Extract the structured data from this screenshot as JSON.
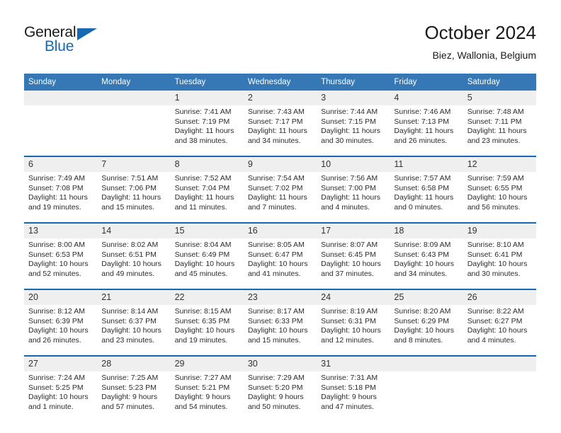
{
  "brand": {
    "word_one": "General",
    "word_two": "Blue",
    "accent_color": "#1668b3"
  },
  "header": {
    "title": "October 2024",
    "subtitle": "Biez, Wallonia, Belgium"
  },
  "calendar": {
    "header_bg": "#3578b5",
    "separator_color": "#1668b3",
    "datebar_bg": "#efefef",
    "weekday_headers": [
      "Sunday",
      "Monday",
      "Tuesday",
      "Wednesday",
      "Thursday",
      "Friday",
      "Saturday"
    ],
    "weeks": [
      [
        {
          "day": "",
          "sunrise": "",
          "sunset": "",
          "daylight": ""
        },
        {
          "day": "",
          "sunrise": "",
          "sunset": "",
          "daylight": ""
        },
        {
          "day": "1",
          "sunrise": "Sunrise: 7:41 AM",
          "sunset": "Sunset: 7:19 PM",
          "daylight": "Daylight: 11 hours and 38 minutes."
        },
        {
          "day": "2",
          "sunrise": "Sunrise: 7:43 AM",
          "sunset": "Sunset: 7:17 PM",
          "daylight": "Daylight: 11 hours and 34 minutes."
        },
        {
          "day": "3",
          "sunrise": "Sunrise: 7:44 AM",
          "sunset": "Sunset: 7:15 PM",
          "daylight": "Daylight: 11 hours and 30 minutes."
        },
        {
          "day": "4",
          "sunrise": "Sunrise: 7:46 AM",
          "sunset": "Sunset: 7:13 PM",
          "daylight": "Daylight: 11 hours and 26 minutes."
        },
        {
          "day": "5",
          "sunrise": "Sunrise: 7:48 AM",
          "sunset": "Sunset: 7:11 PM",
          "daylight": "Daylight: 11 hours and 23 minutes."
        }
      ],
      [
        {
          "day": "6",
          "sunrise": "Sunrise: 7:49 AM",
          "sunset": "Sunset: 7:08 PM",
          "daylight": "Daylight: 11 hours and 19 minutes."
        },
        {
          "day": "7",
          "sunrise": "Sunrise: 7:51 AM",
          "sunset": "Sunset: 7:06 PM",
          "daylight": "Daylight: 11 hours and 15 minutes."
        },
        {
          "day": "8",
          "sunrise": "Sunrise: 7:52 AM",
          "sunset": "Sunset: 7:04 PM",
          "daylight": "Daylight: 11 hours and 11 minutes."
        },
        {
          "day": "9",
          "sunrise": "Sunrise: 7:54 AM",
          "sunset": "Sunset: 7:02 PM",
          "daylight": "Daylight: 11 hours and 7 minutes."
        },
        {
          "day": "10",
          "sunrise": "Sunrise: 7:56 AM",
          "sunset": "Sunset: 7:00 PM",
          "daylight": "Daylight: 11 hours and 4 minutes."
        },
        {
          "day": "11",
          "sunrise": "Sunrise: 7:57 AM",
          "sunset": "Sunset: 6:58 PM",
          "daylight": "Daylight: 11 hours and 0 minutes."
        },
        {
          "day": "12",
          "sunrise": "Sunrise: 7:59 AM",
          "sunset": "Sunset: 6:55 PM",
          "daylight": "Daylight: 10 hours and 56 minutes."
        }
      ],
      [
        {
          "day": "13",
          "sunrise": "Sunrise: 8:00 AM",
          "sunset": "Sunset: 6:53 PM",
          "daylight": "Daylight: 10 hours and 52 minutes."
        },
        {
          "day": "14",
          "sunrise": "Sunrise: 8:02 AM",
          "sunset": "Sunset: 6:51 PM",
          "daylight": "Daylight: 10 hours and 49 minutes."
        },
        {
          "day": "15",
          "sunrise": "Sunrise: 8:04 AM",
          "sunset": "Sunset: 6:49 PM",
          "daylight": "Daylight: 10 hours and 45 minutes."
        },
        {
          "day": "16",
          "sunrise": "Sunrise: 8:05 AM",
          "sunset": "Sunset: 6:47 PM",
          "daylight": "Daylight: 10 hours and 41 minutes."
        },
        {
          "day": "17",
          "sunrise": "Sunrise: 8:07 AM",
          "sunset": "Sunset: 6:45 PM",
          "daylight": "Daylight: 10 hours and 37 minutes."
        },
        {
          "day": "18",
          "sunrise": "Sunrise: 8:09 AM",
          "sunset": "Sunset: 6:43 PM",
          "daylight": "Daylight: 10 hours and 34 minutes."
        },
        {
          "day": "19",
          "sunrise": "Sunrise: 8:10 AM",
          "sunset": "Sunset: 6:41 PM",
          "daylight": "Daylight: 10 hours and 30 minutes."
        }
      ],
      [
        {
          "day": "20",
          "sunrise": "Sunrise: 8:12 AM",
          "sunset": "Sunset: 6:39 PM",
          "daylight": "Daylight: 10 hours and 26 minutes."
        },
        {
          "day": "21",
          "sunrise": "Sunrise: 8:14 AM",
          "sunset": "Sunset: 6:37 PM",
          "daylight": "Daylight: 10 hours and 23 minutes."
        },
        {
          "day": "22",
          "sunrise": "Sunrise: 8:15 AM",
          "sunset": "Sunset: 6:35 PM",
          "daylight": "Daylight: 10 hours and 19 minutes."
        },
        {
          "day": "23",
          "sunrise": "Sunrise: 8:17 AM",
          "sunset": "Sunset: 6:33 PM",
          "daylight": "Daylight: 10 hours and 15 minutes."
        },
        {
          "day": "24",
          "sunrise": "Sunrise: 8:19 AM",
          "sunset": "Sunset: 6:31 PM",
          "daylight": "Daylight: 10 hours and 12 minutes."
        },
        {
          "day": "25",
          "sunrise": "Sunrise: 8:20 AM",
          "sunset": "Sunset: 6:29 PM",
          "daylight": "Daylight: 10 hours and 8 minutes."
        },
        {
          "day": "26",
          "sunrise": "Sunrise: 8:22 AM",
          "sunset": "Sunset: 6:27 PM",
          "daylight": "Daylight: 10 hours and 4 minutes."
        }
      ],
      [
        {
          "day": "27",
          "sunrise": "Sunrise: 7:24 AM",
          "sunset": "Sunset: 5:25 PM",
          "daylight": "Daylight: 10 hours and 1 minute."
        },
        {
          "day": "28",
          "sunrise": "Sunrise: 7:25 AM",
          "sunset": "Sunset: 5:23 PM",
          "daylight": "Daylight: 9 hours and 57 minutes."
        },
        {
          "day": "29",
          "sunrise": "Sunrise: 7:27 AM",
          "sunset": "Sunset: 5:21 PM",
          "daylight": "Daylight: 9 hours and 54 minutes."
        },
        {
          "day": "30",
          "sunrise": "Sunrise: 7:29 AM",
          "sunset": "Sunset: 5:20 PM",
          "daylight": "Daylight: 9 hours and 50 minutes."
        },
        {
          "day": "31",
          "sunrise": "Sunrise: 7:31 AM",
          "sunset": "Sunset: 5:18 PM",
          "daylight": "Daylight: 9 hours and 47 minutes."
        },
        {
          "day": "",
          "sunrise": "",
          "sunset": "",
          "daylight": ""
        },
        {
          "day": "",
          "sunrise": "",
          "sunset": "",
          "daylight": ""
        }
      ]
    ]
  }
}
